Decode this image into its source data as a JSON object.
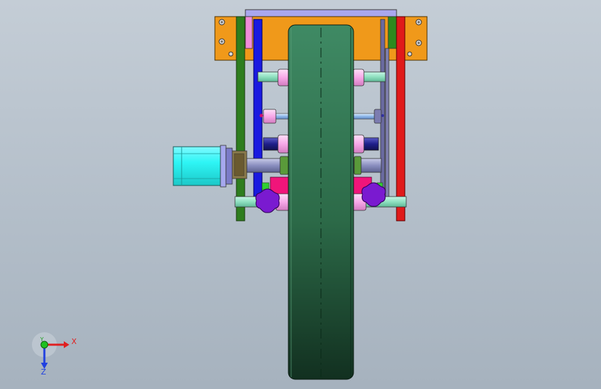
{
  "viewport": {
    "background_top": "#c4cdd6",
    "background_bottom": "#a6b2be"
  },
  "triad": {
    "x_label": "X",
    "y_label": "Y",
    "z_label": "Z",
    "x_color": "#e02020",
    "y_color": "#20a020",
    "z_color": "#2040e0"
  },
  "model": {
    "parts": [
      {
        "name": "top-mounting-plate",
        "color": "#f0991a"
      },
      {
        "name": "top-cover-plate",
        "color": "#a9a7ee"
      },
      {
        "name": "left-green-side-plate",
        "color": "#2e7d1e"
      },
      {
        "name": "right-red-side-plate",
        "color": "#e01a1a"
      },
      {
        "name": "left-blue-bracket",
        "color": "#1a1ae0"
      },
      {
        "name": "drive-wheel",
        "color": "#2f7350"
      },
      {
        "name": "stepper-motor",
        "color": "#2ef5f5"
      },
      {
        "name": "knob",
        "color": "#7a1ad0"
      },
      {
        "name": "crossbar-shaft",
        "color": "#8fe0c0"
      },
      {
        "name": "magenta-clamp-block",
        "color": "#f0157a"
      },
      {
        "name": "pink-bushing",
        "color": "#f7a8e8"
      }
    ]
  }
}
